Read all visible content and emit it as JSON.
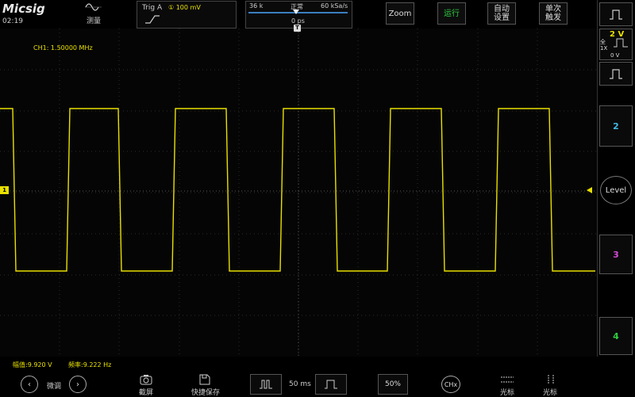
{
  "header": {
    "logo": "Micsig",
    "clock": "02:19",
    "measure_label": "测量",
    "trigger": {
      "title": "Trig  A",
      "level": "① 100 mV"
    },
    "timebase": {
      "depth": "36 k",
      "mode": "正常",
      "rate": "60 kSa/s",
      "position": "0 ps"
    },
    "buttons": {
      "zoom": "Zoom",
      "run": "运行",
      "auto_l1": "自动",
      "auto_l2": "设置",
      "single_l1": "单次",
      "single_l2": "触发"
    }
  },
  "screen": {
    "freq_readout": "CH1: 1.50000 MHz",
    "trigger_time_marker": "T",
    "ch1_marker": "1"
  },
  "right_panel": {
    "ch1": {
      "volts_div": "2 V",
      "full": "全",
      "probe": "1X",
      "offset": "0 V"
    },
    "ch2": "2",
    "ch3": "3",
    "ch4": "4",
    "level": "Level"
  },
  "bottom": {
    "amplitude": "幅值:9.920 V",
    "frequency": "频率:9.222 Hz",
    "fine_label": "微调",
    "screenshot_label": "截屏",
    "quicksave_label": "快捷保存",
    "timebase": "50 ms",
    "percent": "50%",
    "chx": "CHx",
    "cursor1": "光标",
    "cursor2": "光标"
  },
  "colors": {
    "ch1": "#e8e000",
    "ch2": "#3fb8e6",
    "ch3": "#d64ad6",
    "ch4": "#2ecc40",
    "run": "#2ecc40"
  }
}
